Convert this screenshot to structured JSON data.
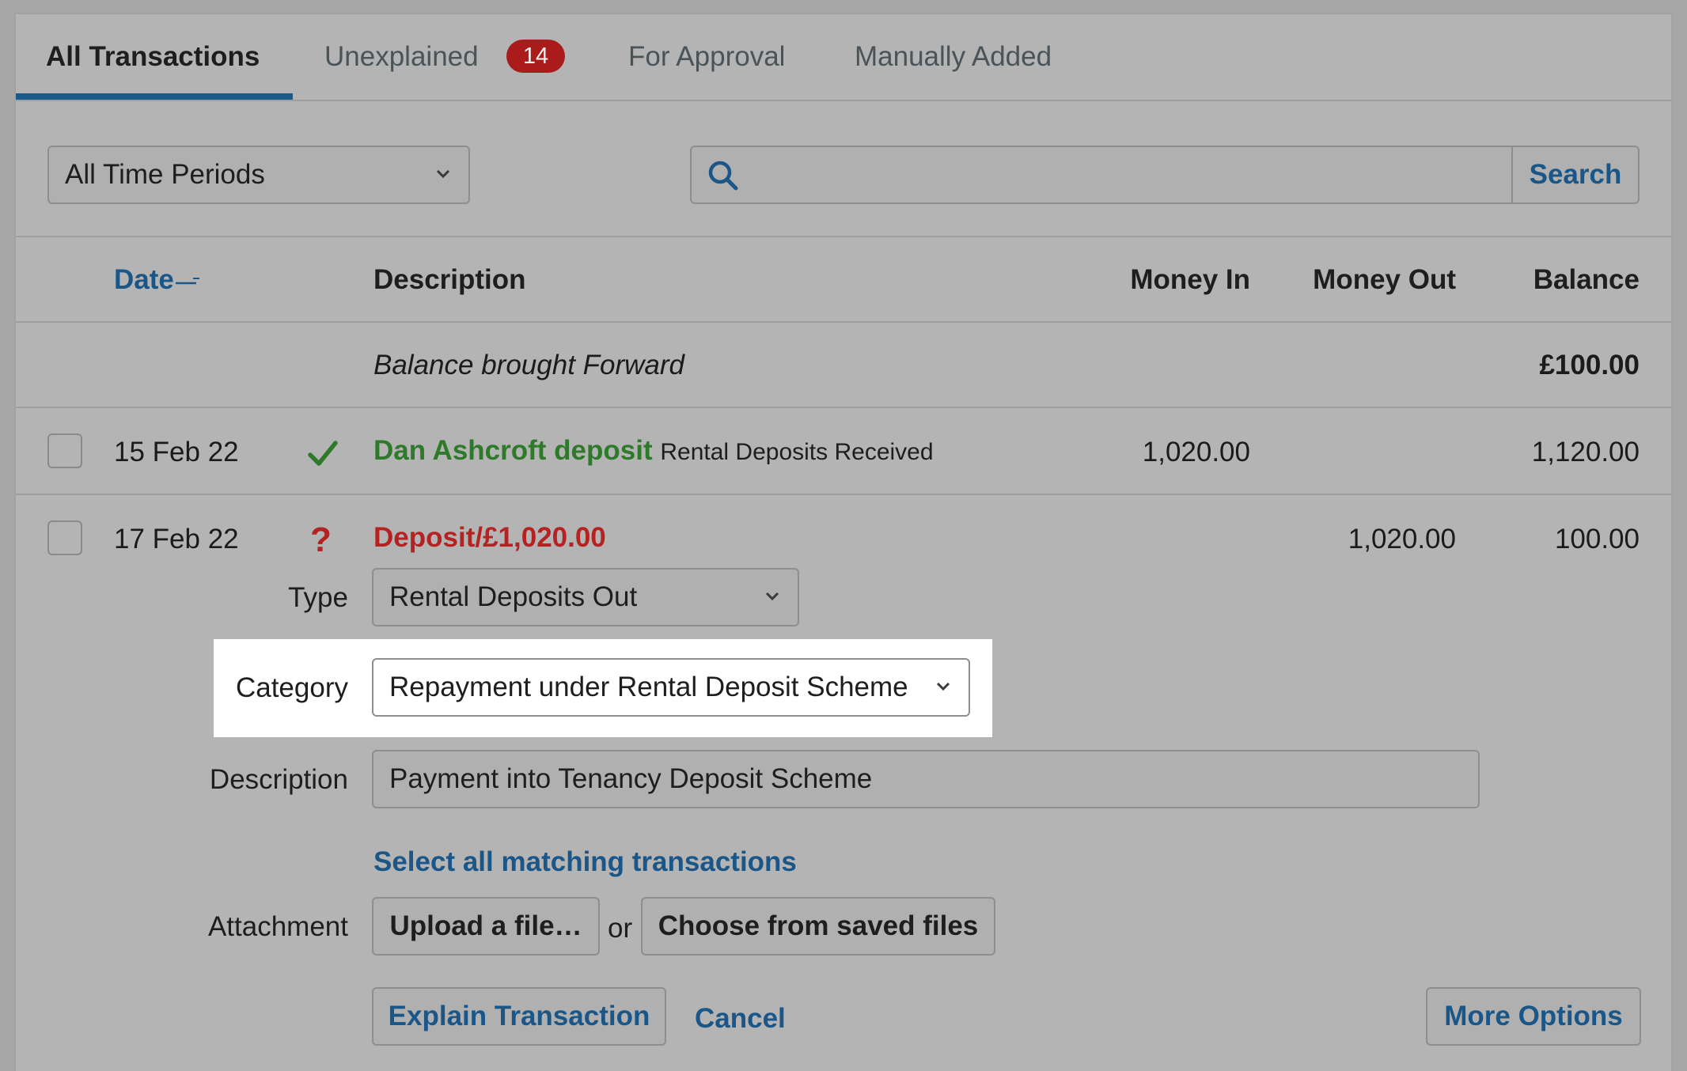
{
  "tabs": [
    {
      "label": "All Transactions",
      "active": true
    },
    {
      "label": "Unexplained",
      "badge": "14"
    },
    {
      "label": "For Approval"
    },
    {
      "label": "Manually Added"
    }
  ],
  "filters": {
    "period": "All Time Periods",
    "search_value": "",
    "search_button": "Search"
  },
  "table": {
    "headers": {
      "date": "Date",
      "description": "Description",
      "money_in": "Money In",
      "money_out": "Money Out",
      "balance": "Balance"
    },
    "balance_forward": {
      "label": "Balance brought Forward",
      "balance": "£100.00"
    },
    "rows": [
      {
        "date": "15 Feb 22",
        "status": "explained",
        "title": "Dan Ashcroft deposit",
        "category": "Rental Deposits Received",
        "money_in": "1,020.00",
        "money_out": "",
        "balance": "1,120.00"
      },
      {
        "date": "17 Feb 22",
        "status": "unexplained",
        "title": "Deposit/£1,020.00",
        "category": "",
        "money_in": "",
        "money_out": "1,020.00",
        "balance": "100.00"
      }
    ]
  },
  "form": {
    "type_label": "Type",
    "type_value": "Rental Deposits Out",
    "category_label": "Category",
    "category_value": "Repayment under Rental Deposit Scheme",
    "description_label": "Description",
    "description_value": "Payment into Tenancy Deposit Scheme",
    "select_all_link": "Select all matching transactions",
    "attachment_label": "Attachment",
    "upload_button": "Upload a file…",
    "or_text": "or",
    "choose_button": "Choose from saved files",
    "explain_button": "Explain Transaction",
    "cancel_link": "Cancel",
    "more_options_button": "More Options"
  },
  "colors": {
    "accent": "#1a5688",
    "success": "#2e7a2a",
    "danger": "#b52222",
    "badge": "#aa1c1c"
  }
}
